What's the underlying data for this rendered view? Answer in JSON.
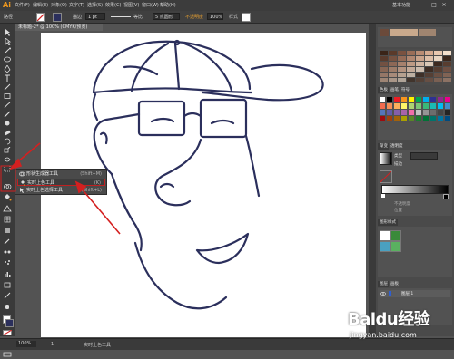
{
  "menubar": {
    "logo": "Ai",
    "items": [
      "文件(F)",
      "编辑(E)",
      "对象(O)",
      "文字(T)",
      "选择(S)",
      "效果(C)",
      "视图(V)",
      "窗口(W)",
      "帮助(H)"
    ],
    "workspace": "基本功能",
    "window_buttons": [
      "—",
      "□",
      "×"
    ]
  },
  "controlbar": {
    "label_left": "路径",
    "stroke_label": "描边",
    "stroke_value": "1 pt",
    "profile_label": "等比",
    "brush_value": "5 点圆形",
    "opacity_label": "不透明度",
    "opacity_value": "100%",
    "style_label": "样式"
  },
  "document": {
    "tab_title": "未标题-2* @ 100% (CMYK/预览)"
  },
  "flyout": {
    "items": [
      {
        "label": "形状生成器工具",
        "shortcut": "(Shift+M)"
      },
      {
        "label": "实时上色工具",
        "shortcut": "(K)"
      },
      {
        "label": "实时上色选择工具",
        "shortcut": "(Shift+L)"
      }
    ],
    "selected_index": 1
  },
  "panels": {
    "swatch_tab_1": "色板",
    "swatch_tab_2": "画笔",
    "swatch_tab_3": "符号",
    "gradient_tab_1": "渐变",
    "gradient_tab_2": "透明度",
    "gradient_type_label": "类型",
    "gradient_stroke_label": "描边",
    "gradient_opacity_label": "不透明度",
    "gradient_position_label": "位置",
    "graphic_styles_tab": "图形样式",
    "layers_tab": "图层",
    "layers_tab_2": "画板",
    "layer_name": "图层 1"
  },
  "statusbar": {
    "zoom": "100%",
    "page": "1",
    "tool_name": "实时上色工具"
  },
  "watermark": {
    "brand": "Baidu经验",
    "url": "jingyan.baidu.com"
  },
  "colors": {
    "accent_red": "#d42020",
    "stroke_navy": "#2b2f5c",
    "ui_dark": "#3a3a3a",
    "logo_orange": "#f39a1e"
  }
}
